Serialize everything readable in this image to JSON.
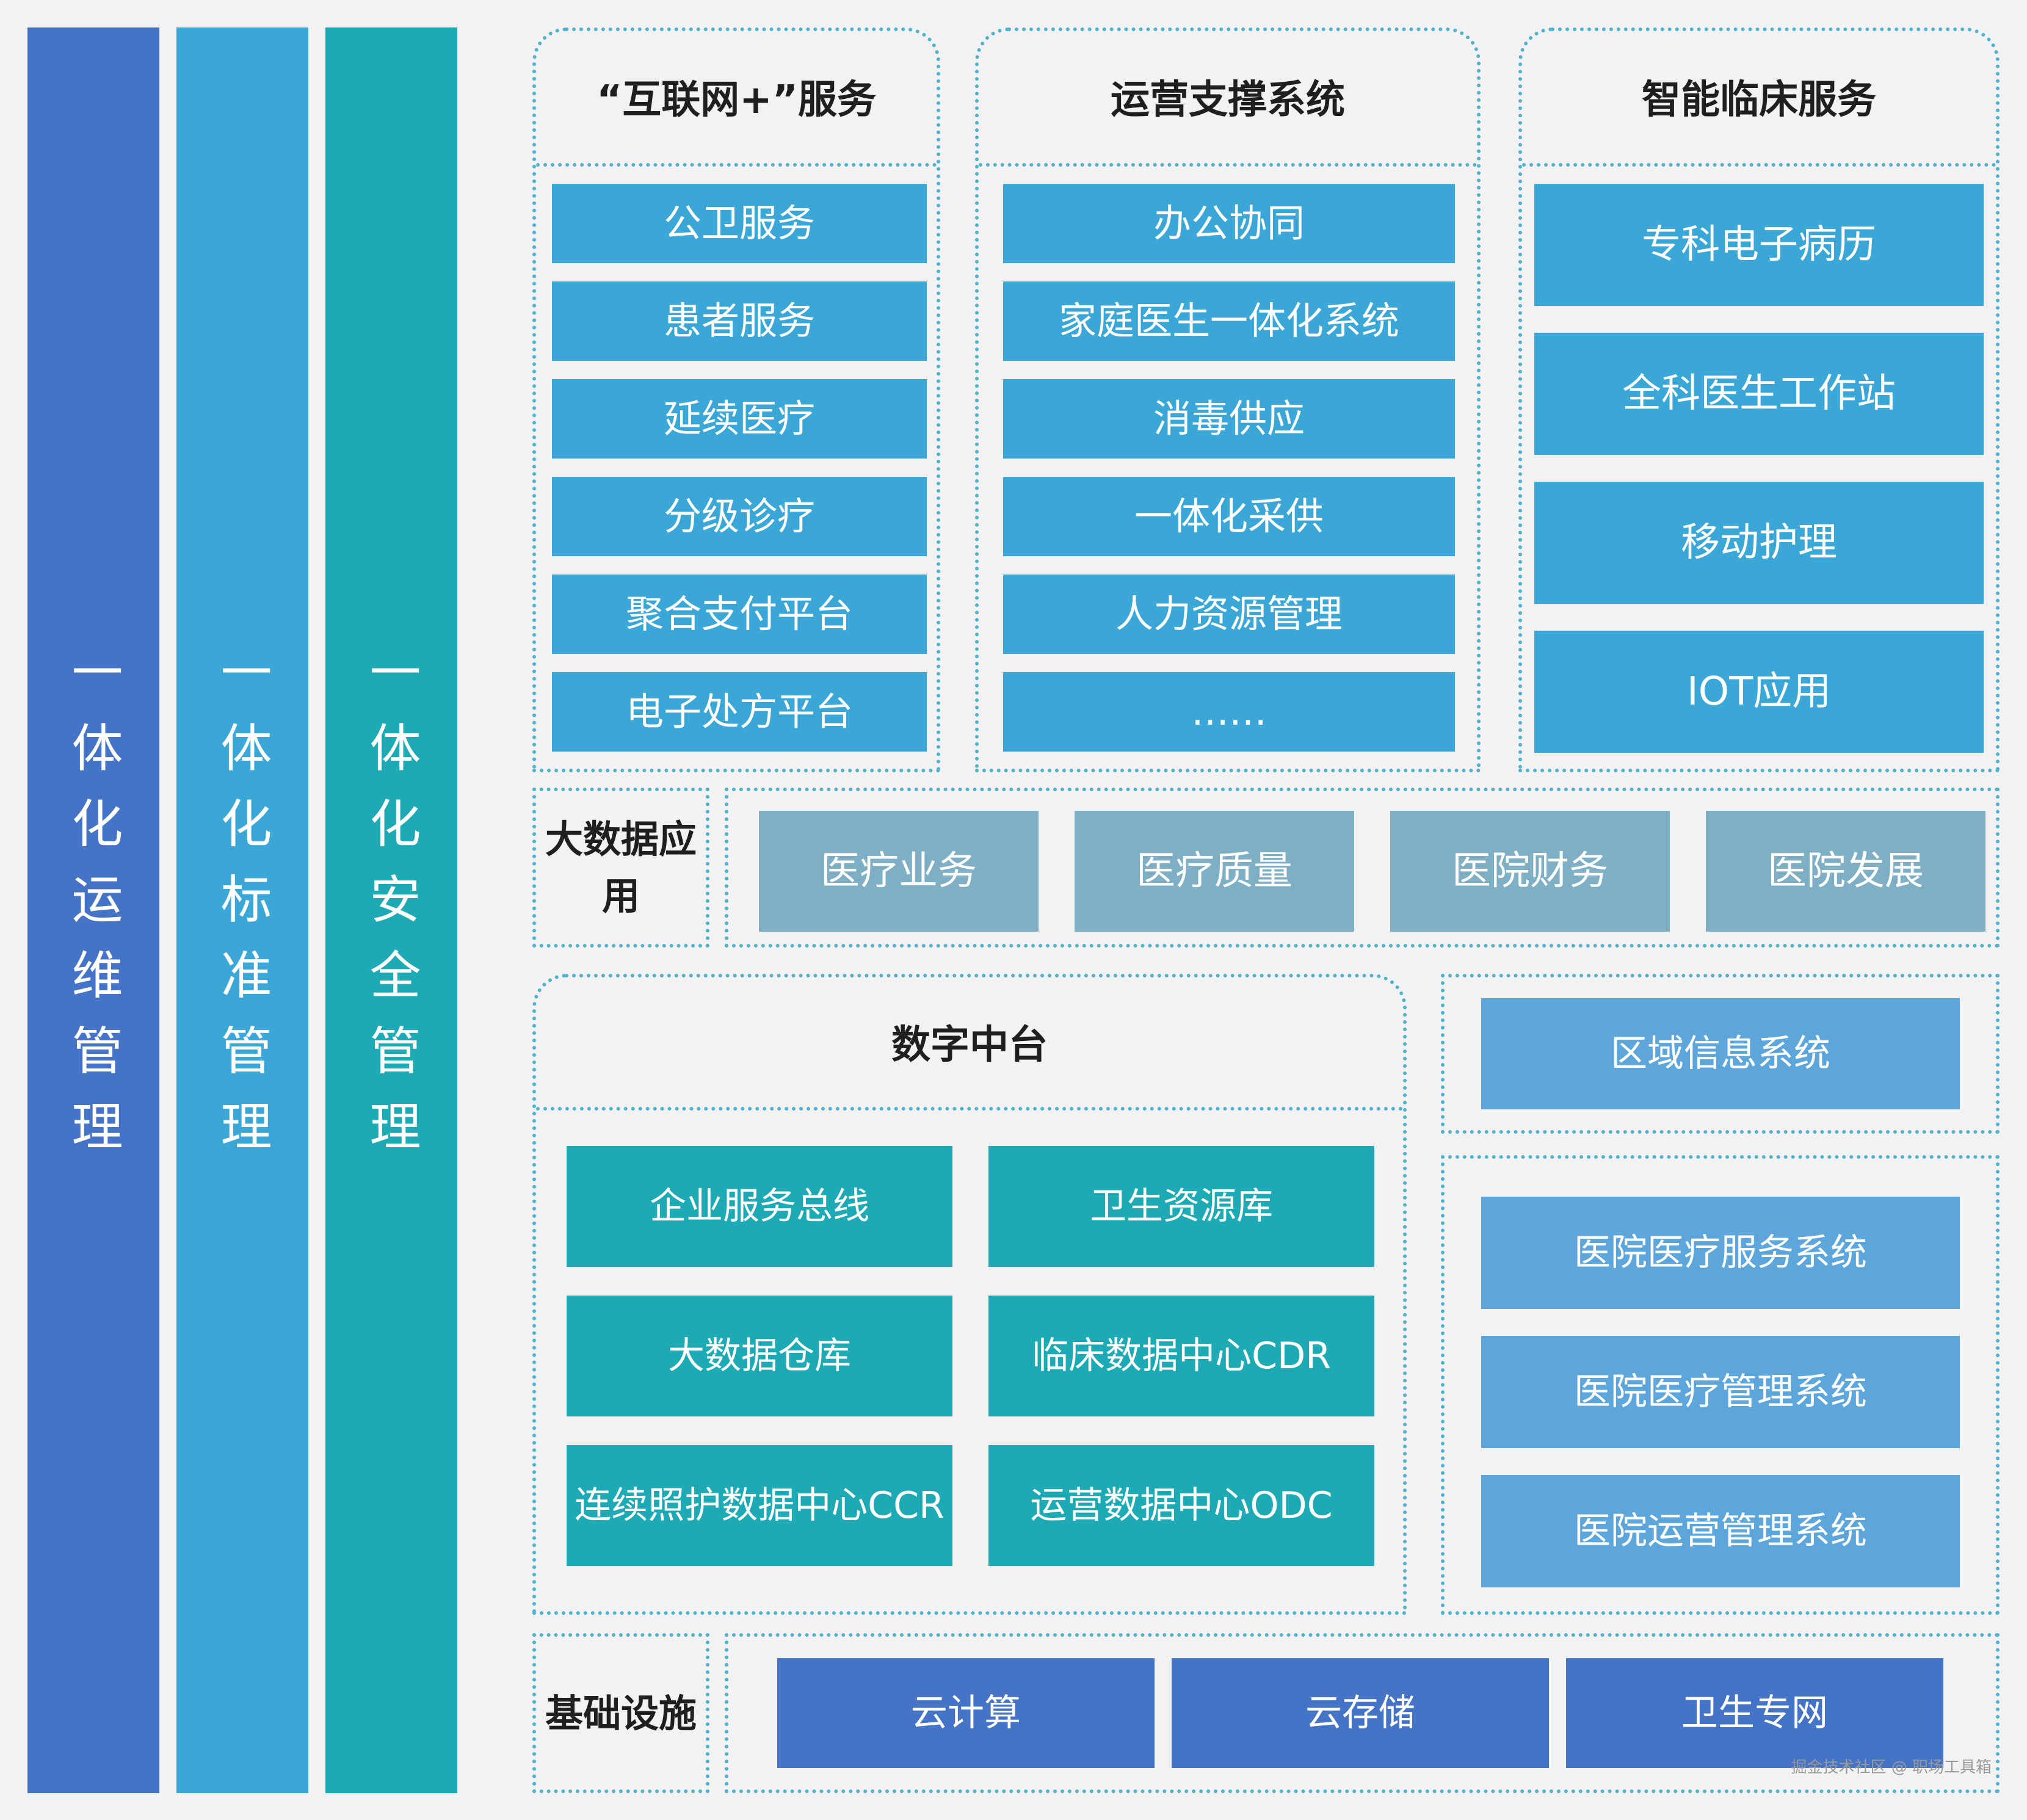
{
  "pillars": [
    {
      "label": "一体化运维管理",
      "color": "#4573c6"
    },
    {
      "label": "一体化标准管理",
      "color": "#3ba7d6"
    },
    {
      "label": "一体化安全管理",
      "color": "#1daab4"
    }
  ],
  "internet_service": {
    "title": "“互联网+”服务",
    "items": [
      "公卫服务",
      "患者服务",
      "延续医疗",
      "分级诊疗",
      "聚合支付平台",
      "电子处方平台"
    ]
  },
  "operations_support": {
    "title": "运营支撑系统",
    "items": [
      "办公协同",
      "家庭医生一体化系统",
      "消毒供应",
      "一体化采供",
      "人力资源管理",
      "……"
    ]
  },
  "clinical_service": {
    "title": "智能临床服务",
    "items": [
      "专科电子病历",
      "全科医生工作站",
      "移动护理",
      "IOT应用"
    ]
  },
  "big_data": {
    "label": "大数据应用",
    "items": [
      "医疗业务",
      "医疗质量",
      "医院财务",
      "医院发展"
    ]
  },
  "digital_platform": {
    "title": "数字中台",
    "items": [
      "企业服务总线",
      "卫生资源库",
      "大数据仓库",
      "临床数据中心CDR",
      "连续照护数据中心CCR",
      "运营数据中心ODC"
    ]
  },
  "regional": {
    "items": [
      "区域信息系统"
    ]
  },
  "hospital_systems": {
    "items": [
      "医院医疗服务系统",
      "医院医疗管理系统",
      "医院运营管理系统"
    ]
  },
  "infrastructure": {
    "label": "基础设施",
    "items": [
      "云计算",
      "云存储",
      "卫生专网"
    ]
  },
  "watermark": "掘金技术社区 @ 职场工具箱",
  "colors": {
    "border_dotted": "#4fb2cf",
    "service_box": "#3ba7d6",
    "bigdata_box": "#7eafc5",
    "platform_box": "#1daab4",
    "hospital_box": "#5da6db",
    "infra_box": "#4573c6"
  }
}
